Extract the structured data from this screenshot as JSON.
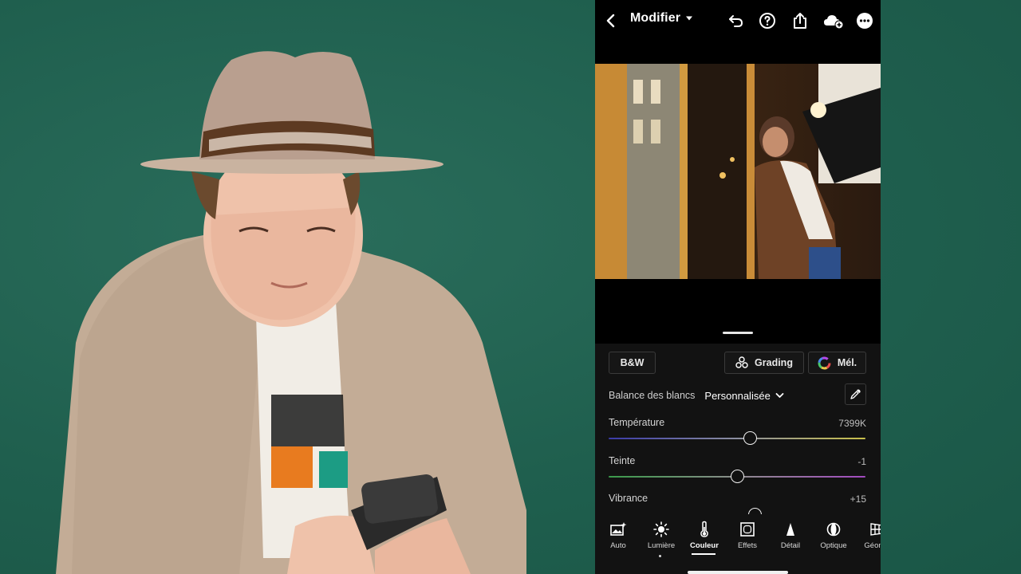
{
  "header": {
    "title": "Modifier"
  },
  "presets": {
    "bw_label": "B&W",
    "grading_label": "Grading",
    "mix_label": "Mél."
  },
  "white_balance": {
    "label": "Balance des blancs",
    "value": "Personnalisée"
  },
  "sliders": [
    {
      "label": "Température",
      "value": "7399K",
      "level": 0.55
    },
    {
      "label": "Teinte",
      "value": "-1",
      "level": 0.5
    },
    {
      "label": "Vibrance",
      "value": "+15"
    }
  ],
  "tools": [
    {
      "label": "Auto",
      "icon": "auto-photo-icon"
    },
    {
      "label": "Lumière",
      "icon": "sun-icon"
    },
    {
      "label": "Couleur",
      "icon": "thermometer-icon",
      "active": true
    },
    {
      "label": "Effets",
      "icon": "vignette-icon"
    },
    {
      "label": "Détail",
      "icon": "triangle-icon"
    },
    {
      "label": "Optique",
      "icon": "lens-icon"
    },
    {
      "label": "Géome",
      "icon": "grid-perspective-icon"
    }
  ],
  "colors": {
    "backdrop": "#1f6150",
    "panel": "#121212",
    "temperature_gradient": [
      "#3a3aa8",
      "#c9c04a"
    ],
    "tint_gradient": [
      "#3a9a4a",
      "#a24ac0"
    ]
  }
}
